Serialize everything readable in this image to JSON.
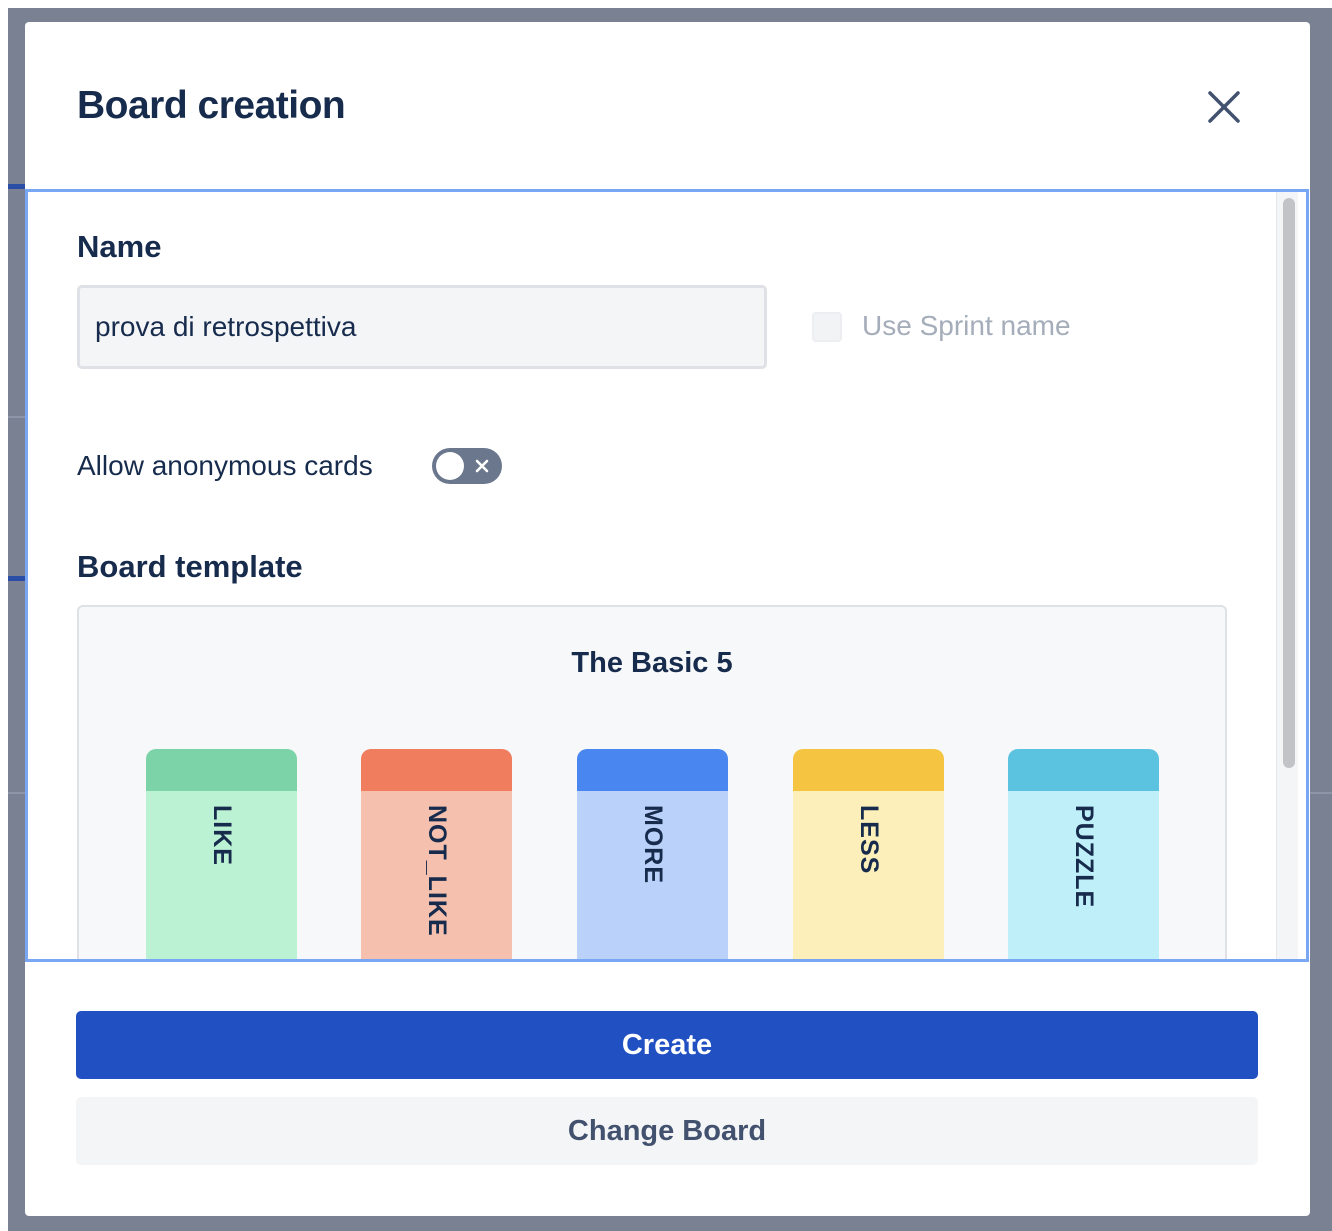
{
  "modal": {
    "title": "Board creation",
    "close_icon": "close-icon"
  },
  "form": {
    "name_label": "Name",
    "name_value": "prova di retrospettiva",
    "use_sprint_name_label": "Use Sprint name",
    "use_sprint_name_checked": false,
    "anonymous_label": "Allow anonymous cards",
    "anonymous_enabled": false,
    "template_label": "Board template"
  },
  "template": {
    "name": "The Basic 5",
    "columns": [
      {
        "label": "LIKE",
        "head_color": "#7dd3a8",
        "body_color": "#bbf2d4"
      },
      {
        "label": "NOT_LIKE",
        "head_color": "#ef7d5e",
        "body_color": "#f5c0ae"
      },
      {
        "label": "MORE",
        "head_color": "#4a86f0",
        "body_color": "#bad2f9"
      },
      {
        "label": "LESS",
        "head_color": "#f5c542",
        "body_color": "#fcefba"
      },
      {
        "label": "PUZZLE",
        "head_color": "#5bc3e0",
        "body_color": "#bff0fa"
      }
    ]
  },
  "actions": {
    "create_label": "Create",
    "change_board_label": "Change Board"
  },
  "colors": {
    "primary": "#2150c3",
    "focus_border": "#7aa7f4",
    "text_dark": "#172b4d"
  }
}
